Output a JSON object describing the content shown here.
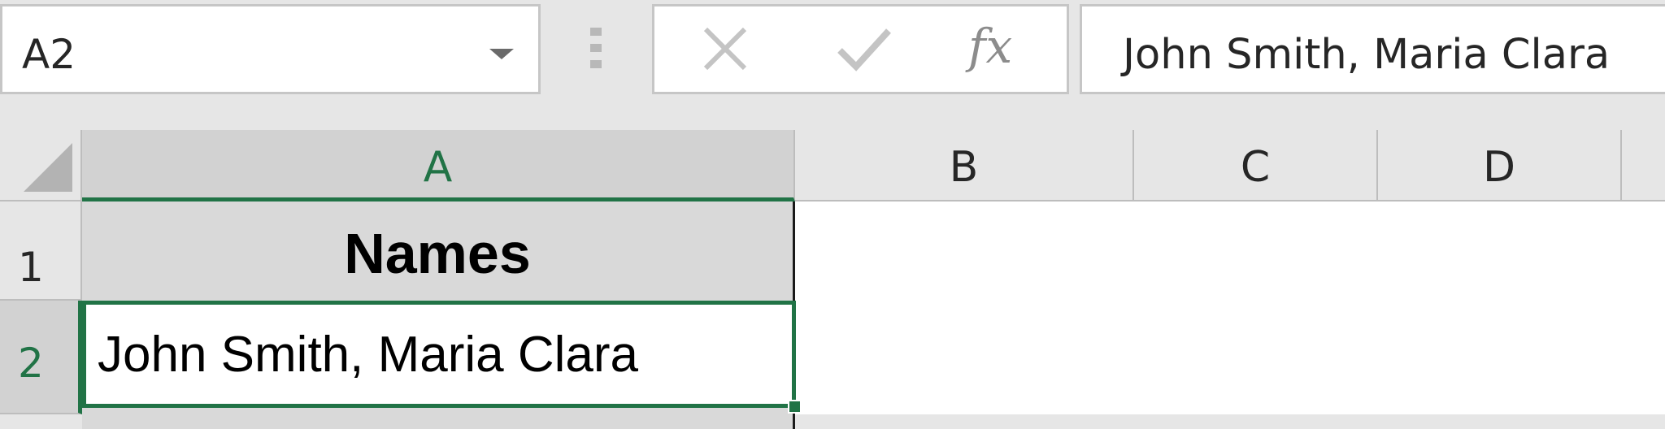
{
  "name_box": {
    "value": "A2"
  },
  "formula_bar": {
    "cancel_icon": "close-x",
    "enter_icon": "checkmark",
    "insert_function_label": "fx",
    "value": "John Smith, Maria Clara"
  },
  "columns": [
    {
      "label": "A",
      "selected": true
    },
    {
      "label": "B",
      "selected": false
    },
    {
      "label": "C",
      "selected": false
    },
    {
      "label": "D",
      "selected": false
    }
  ],
  "rows": [
    {
      "label": "1",
      "selected": false
    },
    {
      "label": "2",
      "selected": true
    }
  ],
  "cells": {
    "A1": "Names",
    "A2": "John Smith, Maria Clara"
  },
  "colors": {
    "selection_green": "#217346",
    "header_fill": "#d9d9d9"
  }
}
